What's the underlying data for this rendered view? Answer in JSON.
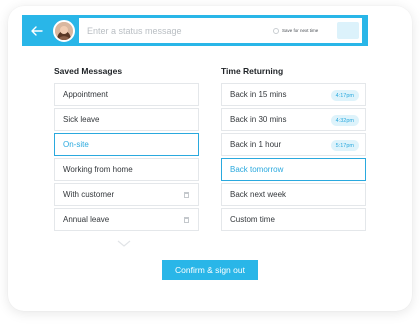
{
  "header": {
    "status_placeholder": "Enter a status message",
    "save_label": "Save for next time",
    "accent": "#29b6e8"
  },
  "saved": {
    "title": "Saved Messages",
    "items": [
      {
        "label": "Appointment"
      },
      {
        "label": "Sick leave"
      },
      {
        "label": "On-site",
        "selected": true
      },
      {
        "label": "Working from home"
      },
      {
        "label": "With customer",
        "icon": "trash-icon"
      },
      {
        "label": "Annual leave",
        "icon": "trash-icon"
      }
    ]
  },
  "returning": {
    "title": "Time Returning",
    "items": [
      {
        "label": "Back in 15 mins",
        "time": "4:17pm"
      },
      {
        "label": "Back in 30 mins",
        "time": "4:32pm"
      },
      {
        "label": "Back in 1 hour",
        "time": "5:17pm"
      },
      {
        "label": "Back tomorrow",
        "selected": true
      },
      {
        "label": "Back next week"
      },
      {
        "label": "Custom time"
      }
    ]
  },
  "footer": {
    "confirm_label": "Confirm & sign out"
  }
}
